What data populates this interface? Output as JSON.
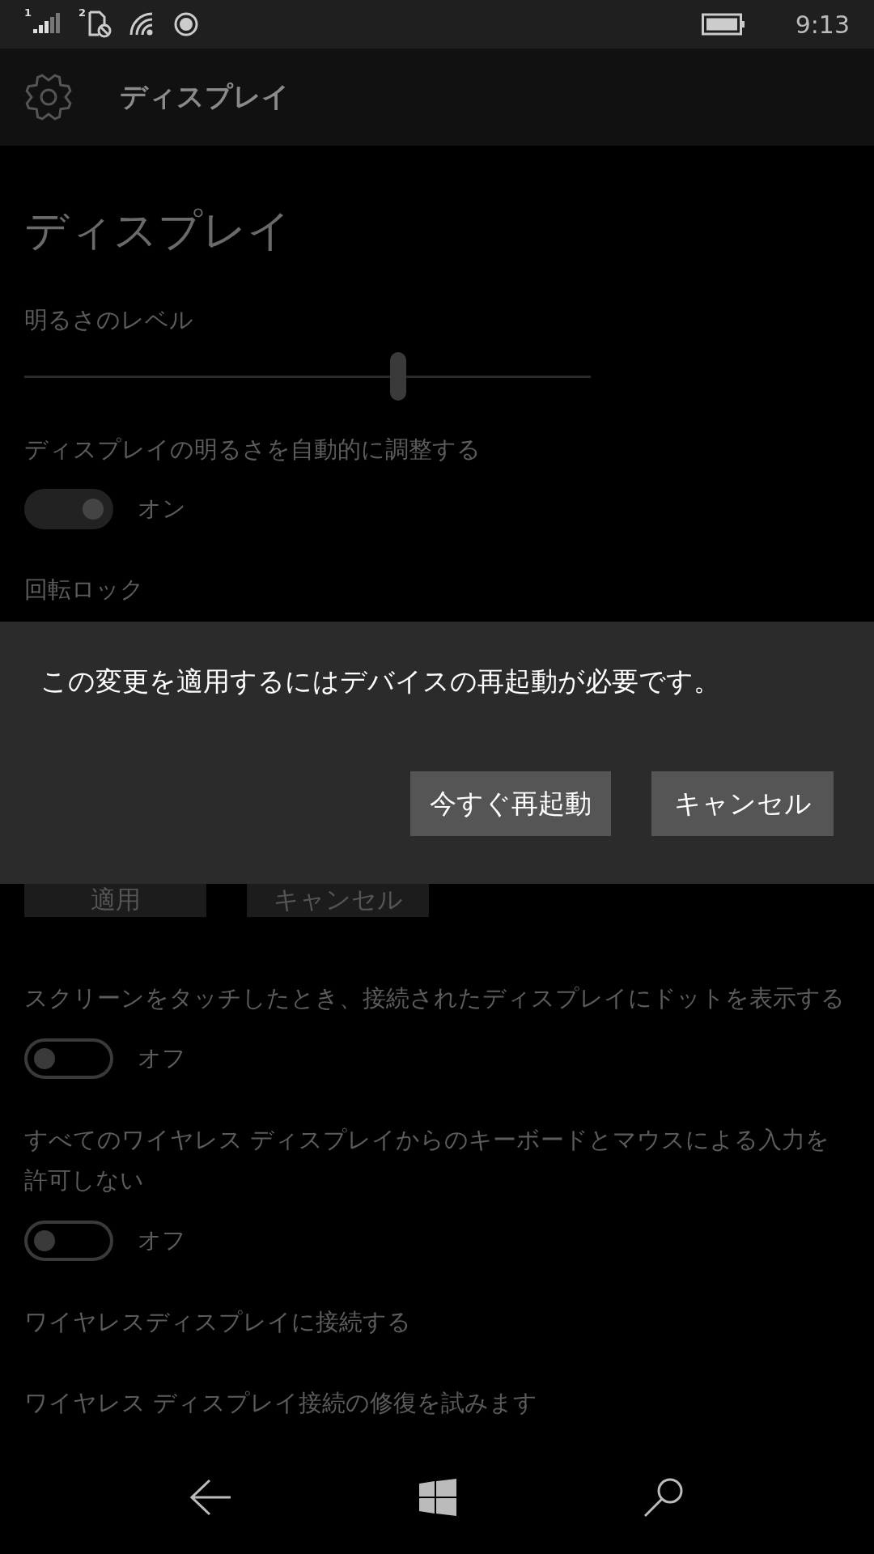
{
  "status_bar": {
    "sim_1": "1",
    "sim_2": "2",
    "time": "9:13"
  },
  "header": {
    "title": "ディスプレイ"
  },
  "page": {
    "title": "ディスプレイ",
    "brightness": {
      "label": "明るさのレベル",
      "level": 0.66
    },
    "auto_brightness": {
      "label": "ディスプレイの明るさを自動的に調整する",
      "on": true,
      "state_text": "オン"
    },
    "rotation_lock": {
      "label": "回転ロック"
    },
    "action_buttons": [
      "適用",
      "キャンセル"
    ],
    "settings": [
      {
        "label": "スクリーンをタッチしたとき、接続されたディスプレイにドットを表示する",
        "on": false,
        "state_text": "オフ"
      },
      {
        "label": "すべてのワイヤレス ディスプレイからのキーボードとマウスによる入力を許可しない",
        "on": false,
        "state_text": "オフ"
      }
    ],
    "links": [
      "ワイヤレスディスプレイに接続する",
      "ワイヤレス ディスプレイ接続の修復を試みます"
    ]
  },
  "dialog": {
    "message": "この変更を適用するにはデバイスの再起動が必要です。",
    "buttons": [
      "今すぐ再起動",
      "キャンセル"
    ]
  }
}
